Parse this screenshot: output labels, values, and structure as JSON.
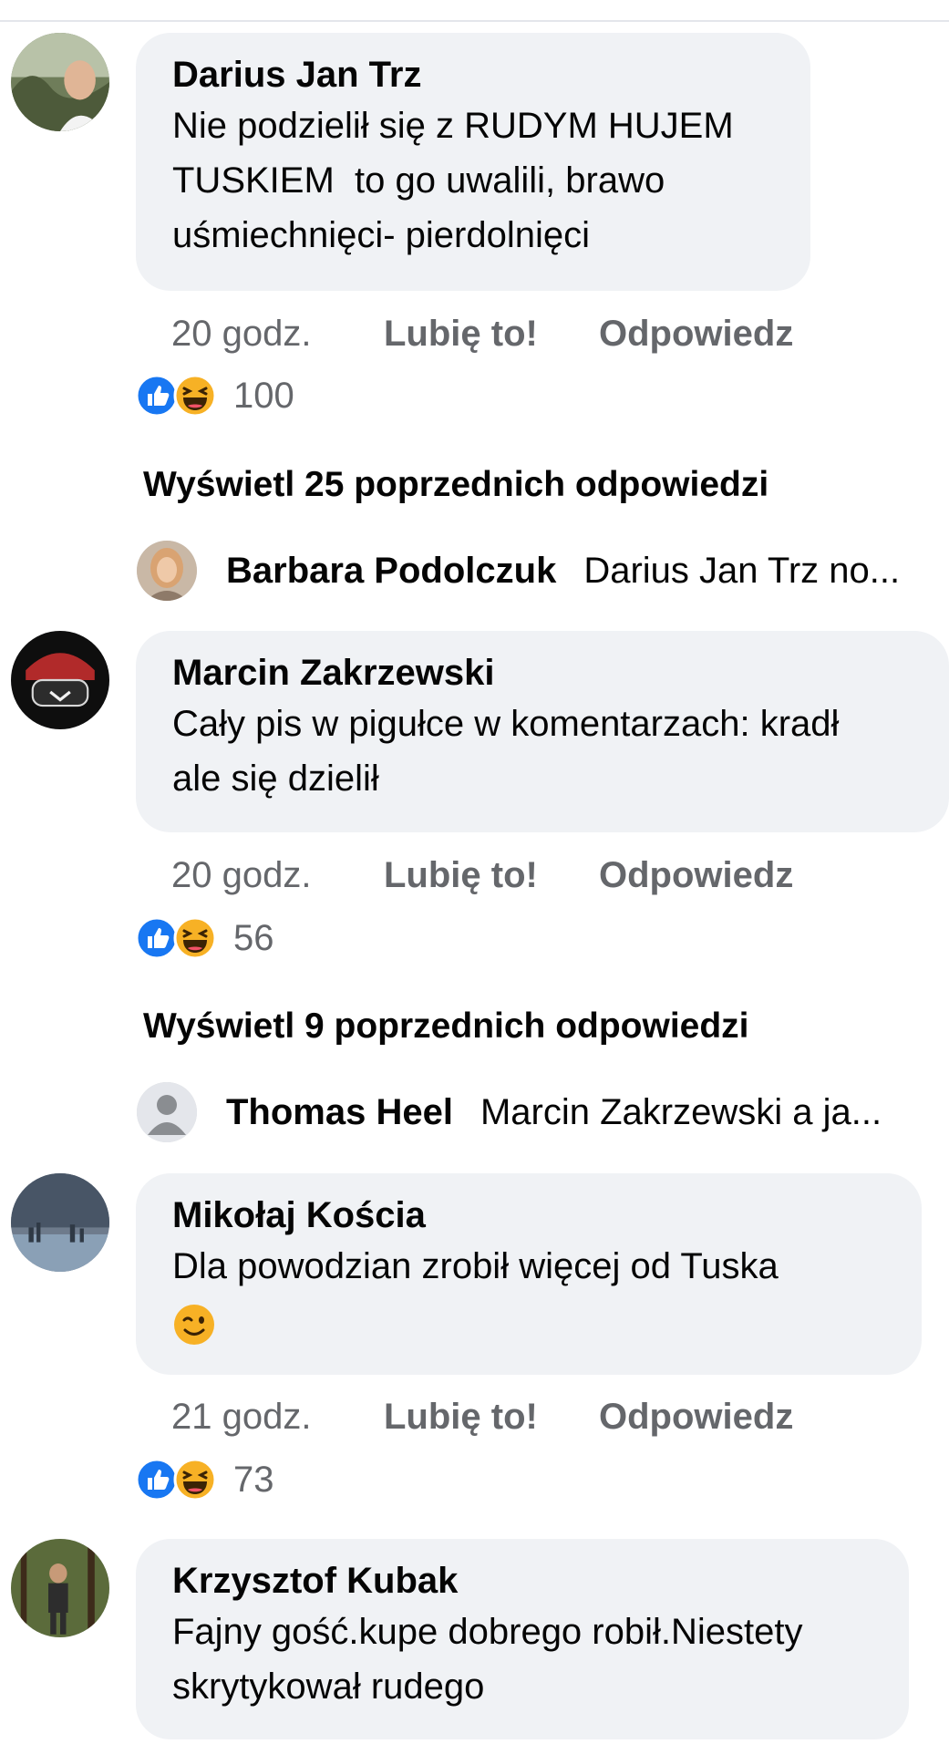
{
  "comments": [
    {
      "author": "Darius Jan Trz",
      "text": "Nie podzielił się z RUDYM HUJEM\nTUSKIEM  to go uwalili, brawo\nuśmiechnięci- pierdolnięci",
      "time": "20 godz.",
      "like_label": "Lubię to!",
      "reply_label": "Odpowiedz",
      "reaction_count": "100",
      "more_replies": "Wyświetl 25 poprzednich odpowiedzi",
      "reply_preview": {
        "author": "Barbara Podolczuk",
        "text": "Darius Jan Trz no..."
      }
    },
    {
      "author": "Marcin Zakrzewski",
      "text": "Cały pis w pigułce w komentarzach: kradł\nale się dzielił",
      "time": "20 godz.",
      "like_label": "Lubię to!",
      "reply_label": "Odpowiedz",
      "reaction_count": "56",
      "more_replies": "Wyświetl 9 poprzednich odpowiedzi",
      "reply_preview": {
        "author": "Thomas Heel",
        "text": "Marcin Zakrzewski a ja..."
      }
    },
    {
      "author": "Mikołaj Kościa",
      "text": "Dla powodzian zrobił więcej od Tuska",
      "time": "21 godz.",
      "like_label": "Lubię to!",
      "reply_label": "Odpowiedz",
      "reaction_count": "73"
    },
    {
      "author": "Krzysztof Kubak",
      "text": "Fajny gość.kupe dobrego robił.Niestety\nskrytykował rudego"
    }
  ],
  "icons": {
    "like": "like-reaction-icon",
    "haha": "haha-reaction-icon",
    "wink": "wink-emoji-icon",
    "default_avatar": "default-avatar-icon"
  },
  "colors": {
    "like_blue": "#1877f2",
    "bubble_bg": "#f0f2f5",
    "secondary_text": "#65676b"
  }
}
